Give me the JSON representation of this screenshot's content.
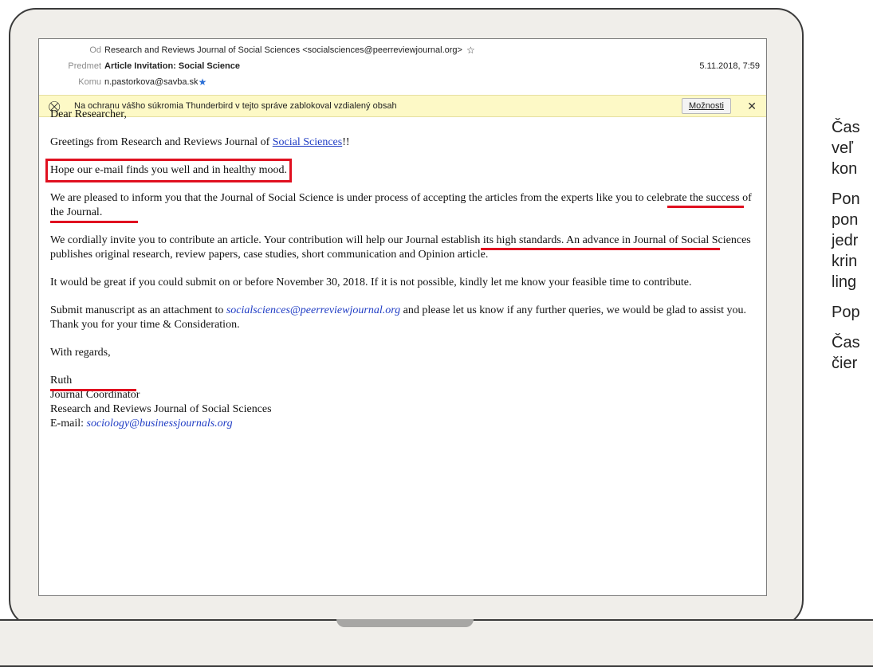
{
  "header": {
    "from_label": "Od",
    "from_value": "Research and Reviews Journal of Social Sciences <socialsciences@peerreviewjournal.org>",
    "subject_label": "Predmet",
    "subject_value": "Article Invitation: Social Science",
    "date": "5.11.2018, 7:59",
    "to_label": "Komu",
    "to_value": "n.pastorkova@savba.sk"
  },
  "notice": {
    "text": "Na ochranu vášho súkromia Thunderbird v tejto správe zablokoval vzdialený obsah",
    "options_label": "Možnosti",
    "close_glyph": "✕"
  },
  "mail": {
    "greeting": "Dear Researcher,",
    "greetings_prefix": "Greetings from Research and Reviews Journal of ",
    "greetings_link": "Social Sciences",
    "greetings_suffix": "!!",
    "hope": "Hope our e-mail finds you well and in healthy mood.",
    "p1": "We are pleased to inform you that the Journal of Social Science is under process of accepting the articles from the experts like you to celebrate the success of the Journal.",
    "p2": "We cordially invite you to contribute an article. Your contribution will help our Journal establish its high standards. An advance in Journal of Social Sciences publishes original research, review papers, case studies, short communication and Opinion article.",
    "p3": "It would be great if you could submit on or before November 30, 2018. If it is not possible, kindly let me know your feasible time to contribute.",
    "p4_prefix": "Submit manuscript as an attachment to ",
    "p4_email": "socialsciences@peerreviewjournal.org",
    "p4_suffix": " and please let us know if any further queries, we would be glad to assist you. Thank you for your time & Consideration.",
    "closing": "With regards,",
    "sig_name": "Ruth",
    "sig_title": "Journal Coordinator",
    "sig_org": "Research and Reviews Journal of Social Sciences",
    "sig_email_label": "E-mail: ",
    "sig_email": "sociology@businessjournals.org"
  },
  "side_text": {
    "l1": "Čas",
    "l2": "veľ",
    "l3": "kon",
    "l4": "Pon",
    "l5": "pon",
    "l6": "jedr",
    "l7": "krin",
    "l8": "ling",
    "l9": "Pop",
    "l10": "Čas",
    "l11": "čier"
  },
  "colors": {
    "annotation_red": "#e01020",
    "link_blue": "#1f3cc4",
    "notice_bg": "#fdf9c6"
  }
}
